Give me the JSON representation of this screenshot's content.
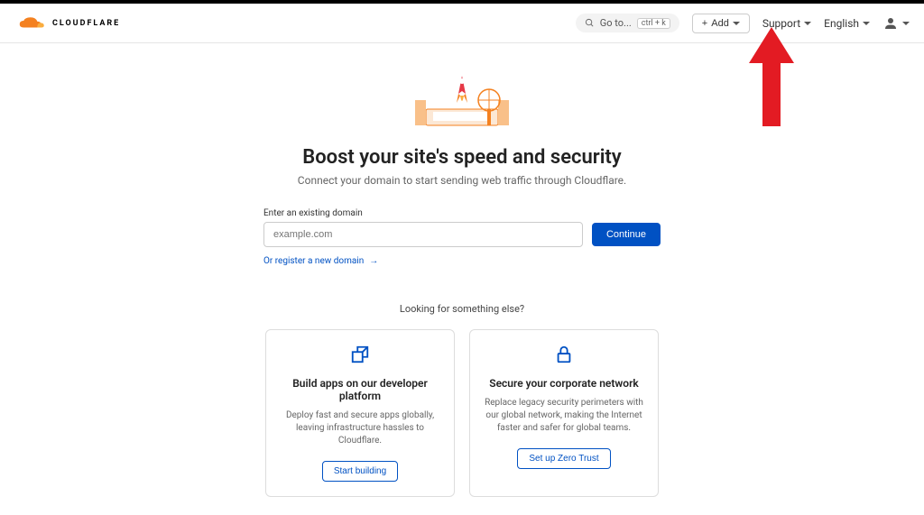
{
  "header": {
    "logo_text": "CLOUDFLARE",
    "goto_label": "Go to...",
    "goto_shortcut": "ctrl + k",
    "add_label": "Add",
    "support_label": "Support",
    "language_label": "English"
  },
  "hero": {
    "title": "Boost your site's speed and security",
    "subtitle": "Connect your domain to start sending web traffic through Cloudflare."
  },
  "form": {
    "label": "Enter an existing domain",
    "placeholder": "example.com",
    "continue_label": "Continue",
    "register_link": "Or register a new domain"
  },
  "looking_for": "Looking for something else?",
  "cards": [
    {
      "title": "Build apps on our developer platform",
      "desc": "Deploy fast and secure apps globally, leaving infrastructure hassles to Cloudflare.",
      "button": "Start building"
    },
    {
      "title": "Secure your corporate network",
      "desc": "Replace legacy security perimeters with our global network, making the Internet faster and safer for global teams.",
      "button": "Set up Zero Trust"
    }
  ]
}
